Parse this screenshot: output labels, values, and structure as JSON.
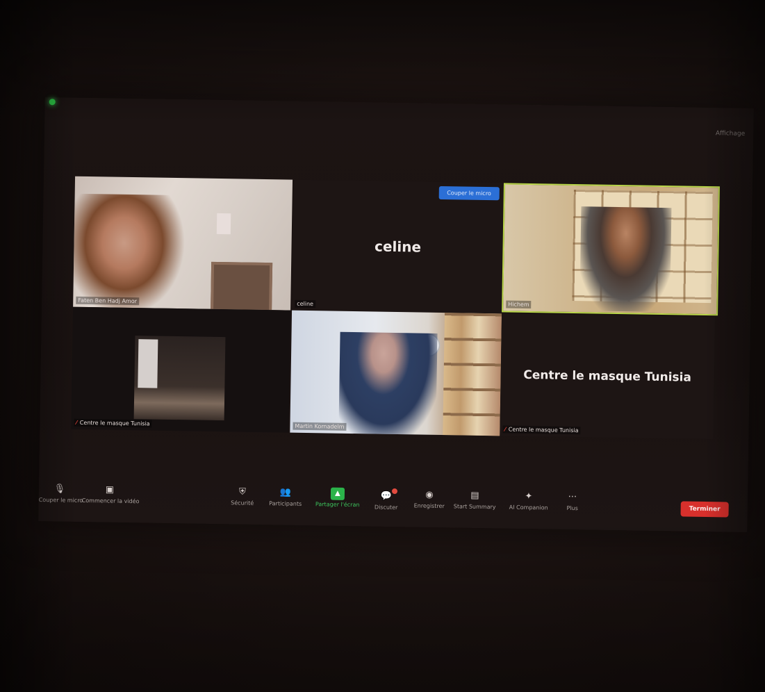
{
  "meeting": {
    "top_right_label": "Affichage"
  },
  "tiles": [
    {
      "name": "Faten Ben Hadj Amor"
    },
    {
      "name": "celine",
      "center_name": "celine",
      "remove_label": "Couper le micro"
    },
    {
      "name": "Hichem"
    },
    {
      "name": "Centre le masque Tunisia"
    },
    {
      "name": "Martin Kornadelm"
    },
    {
      "name": "Centre le masque Tunisia",
      "center_name": "Centre le masque Tunisia"
    }
  ],
  "toolbar": {
    "mute_label": "Couper le micro",
    "video_label": "Commencer la vidéo",
    "security_label": "Sécurité",
    "participants_label": "Participants",
    "share_label": "Partager l'écran",
    "chat_label": "Discuter",
    "record_label": "Enregistrer",
    "summary_label": "Start Summary",
    "ai_label": "AI Companion",
    "more_label": "Plus",
    "end_label": "Terminer"
  },
  "colors": {
    "share_green": "#2bb34a",
    "end_red": "#d8302c",
    "active_speaker_border": "#b9d64a",
    "remove_button_blue": "#2b6fd6"
  },
  "icons": [
    "microphone-icon",
    "video-off-icon",
    "shield-icon",
    "participants-icon",
    "share-screen-icon",
    "chat-icon",
    "record-icon",
    "summary-icon",
    "ai-sparkle-icon",
    "more-icon"
  ]
}
